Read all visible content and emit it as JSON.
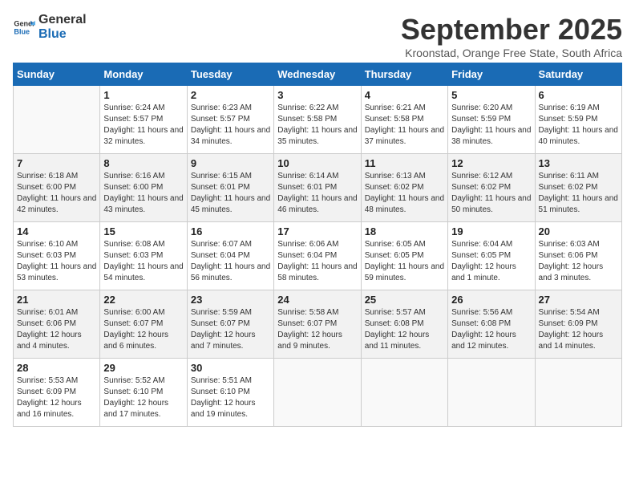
{
  "logo": {
    "line1": "General",
    "line2": "Blue"
  },
  "title": "September 2025",
  "subtitle": "Kroonstad, Orange Free State, South Africa",
  "weekdays": [
    "Sunday",
    "Monday",
    "Tuesday",
    "Wednesday",
    "Thursday",
    "Friday",
    "Saturday"
  ],
  "weeks": [
    [
      {
        "day": "",
        "sunrise": "",
        "sunset": "",
        "daylight": ""
      },
      {
        "day": "1",
        "sunrise": "Sunrise: 6:24 AM",
        "sunset": "Sunset: 5:57 PM",
        "daylight": "Daylight: 11 hours and 32 minutes."
      },
      {
        "day": "2",
        "sunrise": "Sunrise: 6:23 AM",
        "sunset": "Sunset: 5:57 PM",
        "daylight": "Daylight: 11 hours and 34 minutes."
      },
      {
        "day": "3",
        "sunrise": "Sunrise: 6:22 AM",
        "sunset": "Sunset: 5:58 PM",
        "daylight": "Daylight: 11 hours and 35 minutes."
      },
      {
        "day": "4",
        "sunrise": "Sunrise: 6:21 AM",
        "sunset": "Sunset: 5:58 PM",
        "daylight": "Daylight: 11 hours and 37 minutes."
      },
      {
        "day": "5",
        "sunrise": "Sunrise: 6:20 AM",
        "sunset": "Sunset: 5:59 PM",
        "daylight": "Daylight: 11 hours and 38 minutes."
      },
      {
        "day": "6",
        "sunrise": "Sunrise: 6:19 AM",
        "sunset": "Sunset: 5:59 PM",
        "daylight": "Daylight: 11 hours and 40 minutes."
      }
    ],
    [
      {
        "day": "7",
        "sunrise": "Sunrise: 6:18 AM",
        "sunset": "Sunset: 6:00 PM",
        "daylight": "Daylight: 11 hours and 42 minutes."
      },
      {
        "day": "8",
        "sunrise": "Sunrise: 6:16 AM",
        "sunset": "Sunset: 6:00 PM",
        "daylight": "Daylight: 11 hours and 43 minutes."
      },
      {
        "day": "9",
        "sunrise": "Sunrise: 6:15 AM",
        "sunset": "Sunset: 6:01 PM",
        "daylight": "Daylight: 11 hours and 45 minutes."
      },
      {
        "day": "10",
        "sunrise": "Sunrise: 6:14 AM",
        "sunset": "Sunset: 6:01 PM",
        "daylight": "Daylight: 11 hours and 46 minutes."
      },
      {
        "day": "11",
        "sunrise": "Sunrise: 6:13 AM",
        "sunset": "Sunset: 6:02 PM",
        "daylight": "Daylight: 11 hours and 48 minutes."
      },
      {
        "day": "12",
        "sunrise": "Sunrise: 6:12 AM",
        "sunset": "Sunset: 6:02 PM",
        "daylight": "Daylight: 11 hours and 50 minutes."
      },
      {
        "day": "13",
        "sunrise": "Sunrise: 6:11 AM",
        "sunset": "Sunset: 6:02 PM",
        "daylight": "Daylight: 11 hours and 51 minutes."
      }
    ],
    [
      {
        "day": "14",
        "sunrise": "Sunrise: 6:10 AM",
        "sunset": "Sunset: 6:03 PM",
        "daylight": "Daylight: 11 hours and 53 minutes."
      },
      {
        "day": "15",
        "sunrise": "Sunrise: 6:08 AM",
        "sunset": "Sunset: 6:03 PM",
        "daylight": "Daylight: 11 hours and 54 minutes."
      },
      {
        "day": "16",
        "sunrise": "Sunrise: 6:07 AM",
        "sunset": "Sunset: 6:04 PM",
        "daylight": "Daylight: 11 hours and 56 minutes."
      },
      {
        "day": "17",
        "sunrise": "Sunrise: 6:06 AM",
        "sunset": "Sunset: 6:04 PM",
        "daylight": "Daylight: 11 hours and 58 minutes."
      },
      {
        "day": "18",
        "sunrise": "Sunrise: 6:05 AM",
        "sunset": "Sunset: 6:05 PM",
        "daylight": "Daylight: 11 hours and 59 minutes."
      },
      {
        "day": "19",
        "sunrise": "Sunrise: 6:04 AM",
        "sunset": "Sunset: 6:05 PM",
        "daylight": "Daylight: 12 hours and 1 minute."
      },
      {
        "day": "20",
        "sunrise": "Sunrise: 6:03 AM",
        "sunset": "Sunset: 6:06 PM",
        "daylight": "Daylight: 12 hours and 3 minutes."
      }
    ],
    [
      {
        "day": "21",
        "sunrise": "Sunrise: 6:01 AM",
        "sunset": "Sunset: 6:06 PM",
        "daylight": "Daylight: 12 hours and 4 minutes."
      },
      {
        "day": "22",
        "sunrise": "Sunrise: 6:00 AM",
        "sunset": "Sunset: 6:07 PM",
        "daylight": "Daylight: 12 hours and 6 minutes."
      },
      {
        "day": "23",
        "sunrise": "Sunrise: 5:59 AM",
        "sunset": "Sunset: 6:07 PM",
        "daylight": "Daylight: 12 hours and 7 minutes."
      },
      {
        "day": "24",
        "sunrise": "Sunrise: 5:58 AM",
        "sunset": "Sunset: 6:07 PM",
        "daylight": "Daylight: 12 hours and 9 minutes."
      },
      {
        "day": "25",
        "sunrise": "Sunrise: 5:57 AM",
        "sunset": "Sunset: 6:08 PM",
        "daylight": "Daylight: 12 hours and 11 minutes."
      },
      {
        "day": "26",
        "sunrise": "Sunrise: 5:56 AM",
        "sunset": "Sunset: 6:08 PM",
        "daylight": "Daylight: 12 hours and 12 minutes."
      },
      {
        "day": "27",
        "sunrise": "Sunrise: 5:54 AM",
        "sunset": "Sunset: 6:09 PM",
        "daylight": "Daylight: 12 hours and 14 minutes."
      }
    ],
    [
      {
        "day": "28",
        "sunrise": "Sunrise: 5:53 AM",
        "sunset": "Sunset: 6:09 PM",
        "daylight": "Daylight: 12 hours and 16 minutes."
      },
      {
        "day": "29",
        "sunrise": "Sunrise: 5:52 AM",
        "sunset": "Sunset: 6:10 PM",
        "daylight": "Daylight: 12 hours and 17 minutes."
      },
      {
        "day": "30",
        "sunrise": "Sunrise: 5:51 AM",
        "sunset": "Sunset: 6:10 PM",
        "daylight": "Daylight: 12 hours and 19 minutes."
      },
      {
        "day": "",
        "sunrise": "",
        "sunset": "",
        "daylight": ""
      },
      {
        "day": "",
        "sunrise": "",
        "sunset": "",
        "daylight": ""
      },
      {
        "day": "",
        "sunrise": "",
        "sunset": "",
        "daylight": ""
      },
      {
        "day": "",
        "sunrise": "",
        "sunset": "",
        "daylight": ""
      }
    ]
  ]
}
